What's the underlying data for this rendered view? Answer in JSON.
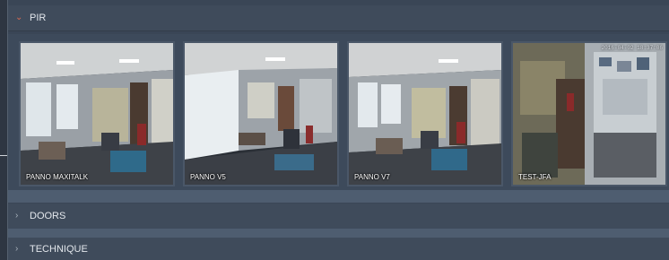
{
  "groups": [
    {
      "label": "PIR",
      "expanded": true,
      "chevron": "chevron-down-icon"
    },
    {
      "label": "DOORS",
      "expanded": false,
      "chevron": "chevron-right-icon"
    },
    {
      "label": "TECHNIQUE",
      "expanded": false,
      "chevron": "chevron-right-icon"
    }
  ],
  "cameras": [
    {
      "label": "PANNO MAXITALK"
    },
    {
      "label": "PANNO V5"
    },
    {
      "label": "PANNO V7"
    },
    {
      "label": "TEST-JFA",
      "timestamp": "2016-04-02 18:37:06"
    }
  ],
  "colors": {
    "accent_chevron": "#d96a52",
    "panel_bg": "#3a4656",
    "header_bg": "#3f4b5b"
  }
}
